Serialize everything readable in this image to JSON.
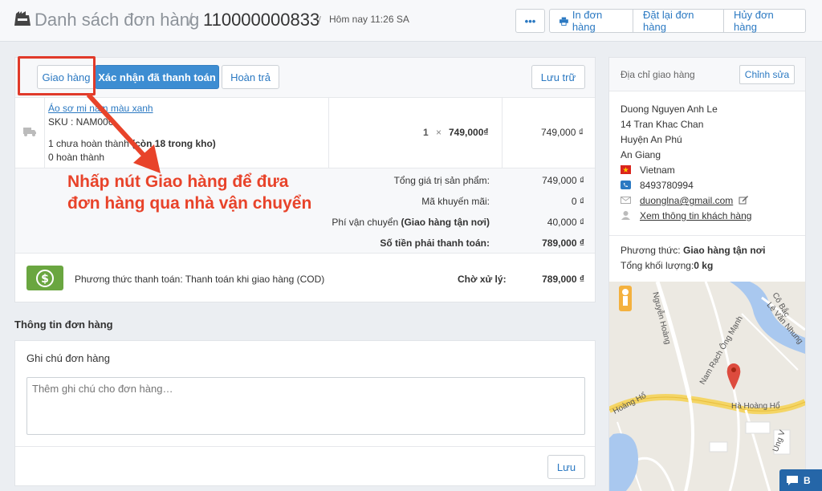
{
  "header": {
    "page_title": "Danh sách đơn hàng",
    "separator": "/",
    "order_id": "110000000833",
    "timestamp": "Hôm nay 11:26 SA",
    "more_label": "•••",
    "print_label": "In đơn hàng",
    "reorder_label": "Đặt lại đơn hàng",
    "cancel_label": "Hủy đơn hàng"
  },
  "order": {
    "actions": {
      "ship_label": "Giao hàng",
      "confirm_paid_label": "Xác nhận đã thanh toán",
      "refund_label": "Hoàn trả",
      "archive_label": "Lưu trữ"
    },
    "item": {
      "name": "Áo sơ mi nam màu xanh",
      "sku": "SKU : NAM006",
      "unfulfilled_prefix": "1 chưa hoàn thành",
      "unfulfilled_stock": " (còn 18 trong kho)",
      "fulfilled": "0 hoàn thành",
      "quantity": "1",
      "times": "×",
      "unit_price": "749,000₫",
      "line_total": "749,000 ₫"
    },
    "summary": {
      "subtotal_label": "Tổng giá trị sản phẩm:",
      "subtotal_value": "749,000 ₫",
      "discount_label": "Mã khuyến mãi:",
      "discount_value": "0 ₫",
      "shipping_label_prefix": "Phí vận chuyển ",
      "shipping_label_method": "(Giao hàng tận nơi)",
      "shipping_value": "40,000 ₫",
      "total_label": "Số tiền phải thanh toán:",
      "total_value": "789,000 ₫"
    },
    "payment": {
      "method_text": "Phương thức thanh toán: Thanh toán khi giao hàng (COD)",
      "status_label": "Chờ xử lý:",
      "amount": "789,000 ₫"
    }
  },
  "annotation": {
    "line1": "Nhấp nút Giao hàng để đưa",
    "line2": "đơn hàng qua nhà vận chuyển"
  },
  "order_info": {
    "section_title": "Thông tin đơn hàng",
    "note_label": "Ghi chú đơn hàng",
    "note_placeholder": "Thêm ghi chú cho đơn hàng…",
    "save_label": "Lưu"
  },
  "shipping_address": {
    "title": "Địa chỉ giao hàng",
    "edit_label": "Chỉnh sửa",
    "name": "Duong Nguyen Anh Le",
    "street": "14 Tran Khac Chan",
    "district": "Huyện An Phú",
    "province": "An Giang",
    "country": "Vietnam",
    "phone": "8493780994",
    "email": "duonglna@gmail.com",
    "customer_link": "Xem thông tin khách hàng",
    "method_label": "Phương thức: ",
    "method_value": "Giao hàng tận nơi",
    "weight_label": "Tổng khối lượng:",
    "weight_value": "0 kg"
  },
  "map": {
    "labels": {
      "street1": "Nguyễn Hoàng",
      "street2": "Nam Rạch Ông Mạnh",
      "street3": "Hà Hoàng Hổ",
      "street4": "Hoàng Hổ",
      "street5": "Lê Văn Nhung",
      "street6": "Cô Bắc",
      "street7": "Ung V"
    }
  },
  "chat": {
    "label": "B"
  },
  "colors": {
    "accent": "#3d8dd2",
    "link": "#2b79c2",
    "annotation": "#e8432a",
    "cash": "#6aa640"
  }
}
